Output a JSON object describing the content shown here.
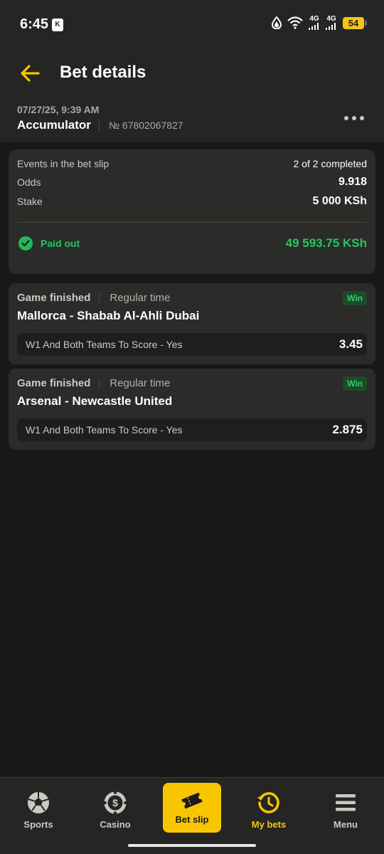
{
  "status_bar": {
    "time": "6:45",
    "app_badge": "K",
    "network_1": "4G",
    "network_2": "4G",
    "battery": "54"
  },
  "header": {
    "title": "Bet details",
    "back_icon": "arrow-left-icon",
    "more_icon": "more-horizontal-icon"
  },
  "bet": {
    "date": "07/27/25, 9:39 AM",
    "type": "Accumulator",
    "number": "№ 67802067827"
  },
  "summary": {
    "events_label": "Events in the bet slip",
    "events_value": "2 of 2 completed",
    "odds_label": "Odds",
    "odds_value": "9.918",
    "stake_label": "Stake",
    "stake_value": "5 000 KSh",
    "paid_label": "Paid out",
    "paid_amount": "49 593.75 KSh"
  },
  "events": [
    {
      "status": "Game finished",
      "period": "Regular time",
      "result": "Win",
      "match": "Mallorca - Shabab Al-Ahli Dubai",
      "market": "W1 And Both Teams To Score - Yes",
      "odds": "3.45"
    },
    {
      "status": "Game finished",
      "period": "Regular time",
      "result": "Win",
      "match": "Arsenal - Newcastle United",
      "market": "W1 And Both Teams To Score - Yes",
      "odds": "2.875"
    }
  ],
  "nav": {
    "items": [
      {
        "label": "Sports",
        "icon": "soccer-ball-icon"
      },
      {
        "label": "Casino",
        "icon": "casino-chip-icon"
      },
      {
        "label": "Bet slip",
        "icon": "ticket-icon"
      },
      {
        "label": "My bets",
        "icon": "history-icon"
      },
      {
        "label": "Menu",
        "icon": "hamburger-menu-icon"
      }
    ],
    "active": "My bets"
  },
  "colors": {
    "accent": "#f7c600",
    "success": "#27c65f",
    "background": "#181816",
    "card": "#2b2b29"
  }
}
